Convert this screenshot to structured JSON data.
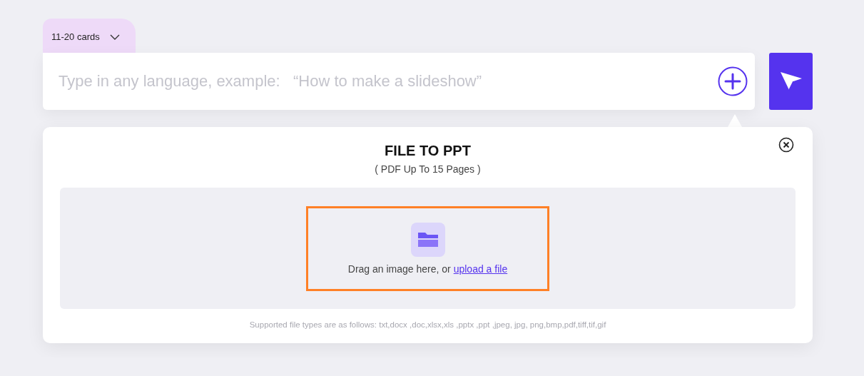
{
  "card_count_dropdown": {
    "label": "11-20 cards"
  },
  "prompt": {
    "placeholder": "Type in any language, example:   “How to make a slideshow”"
  },
  "panel": {
    "title": "FILE TO PPT",
    "subtitle": "( PDF Up To 15 Pages )",
    "dropzone": {
      "highlighted": true,
      "text": "Drag an image here, or ",
      "link": "upload a file"
    },
    "supported_types": "Supported file types are as follows: txt,docx ,doc,xlsx,xls ,pptx ,ppt ,jpeg, jpg, png,bmp,pdf,tiff,tif,gif"
  }
}
